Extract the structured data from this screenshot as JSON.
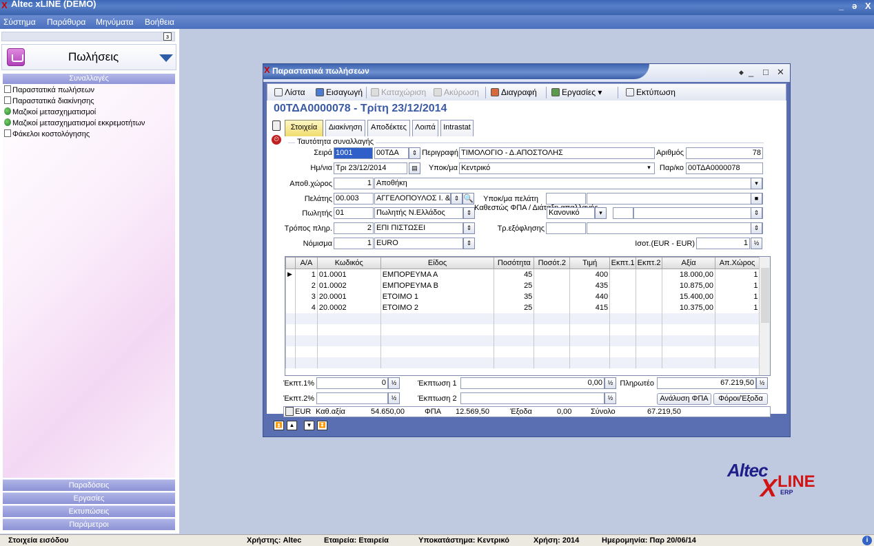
{
  "app": {
    "title": "Altec xLINE (DEMO)",
    "min": "_",
    "restore": "ə",
    "close": "X"
  },
  "menu": [
    "Σύστημα",
    "Παράθυρα",
    "Μηνύματα",
    "Βοήθεια"
  ],
  "sidebar": {
    "pin": "з",
    "module_title": "Πωλήσεις",
    "section": "Συναλλαγές",
    "items": [
      {
        "label": "Παραστατικά πωλήσεων",
        "icon": "document-icon"
      },
      {
        "label": "Παραστατικά διακίνησης",
        "icon": "document-icon"
      },
      {
        "label": "Μαζικοί μετασχηματισμοί",
        "icon": "globe-icon"
      },
      {
        "label": "Μαζικοί μετασχηματισμοί εκκρεμοτήτων",
        "icon": "globe-icon"
      },
      {
        "label": "Φάκελοι κοστολόγησης",
        "icon": "folder-icon"
      }
    ],
    "bottom_buttons": [
      "Παραδόσεις",
      "Εργασίες",
      "Εκτυπώσεις",
      "Παράμετροι"
    ]
  },
  "document": {
    "window_title": "Παραστατικά πωλήσεων",
    "toolbar": {
      "list": "Λίστα",
      "insert": "Εισαγωγή",
      "save": "Καταχώριση",
      "cancel": "Ακύρωση",
      "delete": "Διαγραφή",
      "tasks": "Εργασίες",
      "print": "Εκτύπωση"
    },
    "heading": "00ΤΔΑ0000078 - Τρίτη 23/12/2014",
    "tabs": [
      "Στοιχεία",
      "Διακίνηση",
      "Αποδέκτες",
      "Λοιπά",
      "Intrastat"
    ],
    "group_title": "Ταυτότητα συναλλαγής",
    "labels": {
      "series": "Σειρά",
      "description": "Περιγραφή",
      "number": "Αριθμός",
      "date": "Ημ/νια",
      "branch": "Υποκ/μα",
      "parko": "Παρ/κο",
      "warehouse": "Αποθ.χώρος",
      "customer": "Πελάτης",
      "cust_branch": "Υποκ/μα πελάτη",
      "salesman": "Πωλητής",
      "vat_status": "Καθεστώς ΦΠΑ / Διάταξη απαλλαγής",
      "payment": "Τρόπος πληρ.",
      "settlement": "Τρ.εξόφλησης",
      "currency": "Νόμισμα",
      "parity": "Ισοτ.(EUR - EUR)"
    },
    "values": {
      "series_code": "1001",
      "series_name": "00ΤΔΑ",
      "description": "ΤΙΜΟΛΟΓΙΟ - Δ.ΑΠΟΣΤΟΛΗΣ",
      "number": "78",
      "date": "Τρι 23/12/2014",
      "branch": "Κεντρικό",
      "parko": "00ΤΔΑ0000078",
      "warehouse_code": "1",
      "warehouse_name": "Αποθήκη",
      "customer_code": "00.003",
      "customer_name": "ΑΓΓΕΛΟΠΟΥΛΟΣ Ι. & Σ",
      "salesman_code": "01",
      "salesman_name": "Πωλητής Ν.Ελλάδος",
      "vat_status": "Κανονικό",
      "payment_code": "2",
      "payment_name": "ΕΠΙ ΠΙΣΤΩΣΕΙ",
      "currency_code": "1",
      "currency_name": "EURO",
      "parity": "1"
    },
    "grid": {
      "columns": [
        "Α/Α",
        "Κωδικός",
        "Είδος",
        "Ποσότητα",
        "Ποσότ.2",
        "Τιμή",
        "Εκπτ.1",
        "Εκπτ.2",
        "Αξία",
        "Απ.Χώρος"
      ],
      "rows": [
        [
          "1",
          "01.0001",
          "ΕΜΠΟΡΕΥΜΑ Α",
          "45",
          "",
          "400",
          "",
          "",
          "18.000,00",
          "1"
        ],
        [
          "2",
          "01.0002",
          "ΕΜΠΟΡΕΥΜΑ Β",
          "25",
          "",
          "435",
          "",
          "",
          "10.875,00",
          "1"
        ],
        [
          "3",
          "20.0001",
          "ΕΤΟΙΜΟ 1",
          "35",
          "",
          "440",
          "",
          "",
          "15.400,00",
          "1"
        ],
        [
          "4",
          "20.0002",
          "ΕΤΟΙΜΟ 2",
          "25",
          "",
          "415",
          "",
          "",
          "10.375,00",
          "1"
        ]
      ]
    },
    "totals": {
      "disc1_pct_label": "Έκπτ.1%",
      "disc1_pct": "0",
      "disc2_pct_label": "Έκπτ.2%",
      "disc1_label": "Έκπτωση 1",
      "disc1": "0,00",
      "disc2_label": "Έκπτωση 2",
      "payable_label": "Πληρωτέο",
      "payable": "67.219,50",
      "vat_analysis": "Ανάλυση ΦΠΑ",
      "taxes": "Φόροι/Έξοδα"
    },
    "footer": {
      "currency": "EUR",
      "net_label": "Καθ.αξία",
      "net": "54.650,00",
      "vat_label": "ΦΠΑ",
      "vat": "12.569,50",
      "exp_label": "Έξοδα",
      "exp": "0,00",
      "total_label": "Σύνολο",
      "total": "67.219,50"
    }
  },
  "logo": {
    "altec": "Altec",
    "x": "X",
    "line": "LINE",
    "erp": "ERP"
  },
  "status": {
    "entry": "Στοιχεία εισόδου",
    "user": "Χρήστης: Altec",
    "company": "Εταιρεία: Εταιρεία",
    "branch": "Υποκατάστημα: Κεντρικό",
    "year": "Χρήση: 2014",
    "date": "Ημερομηνία: Παρ 20/06/14"
  }
}
